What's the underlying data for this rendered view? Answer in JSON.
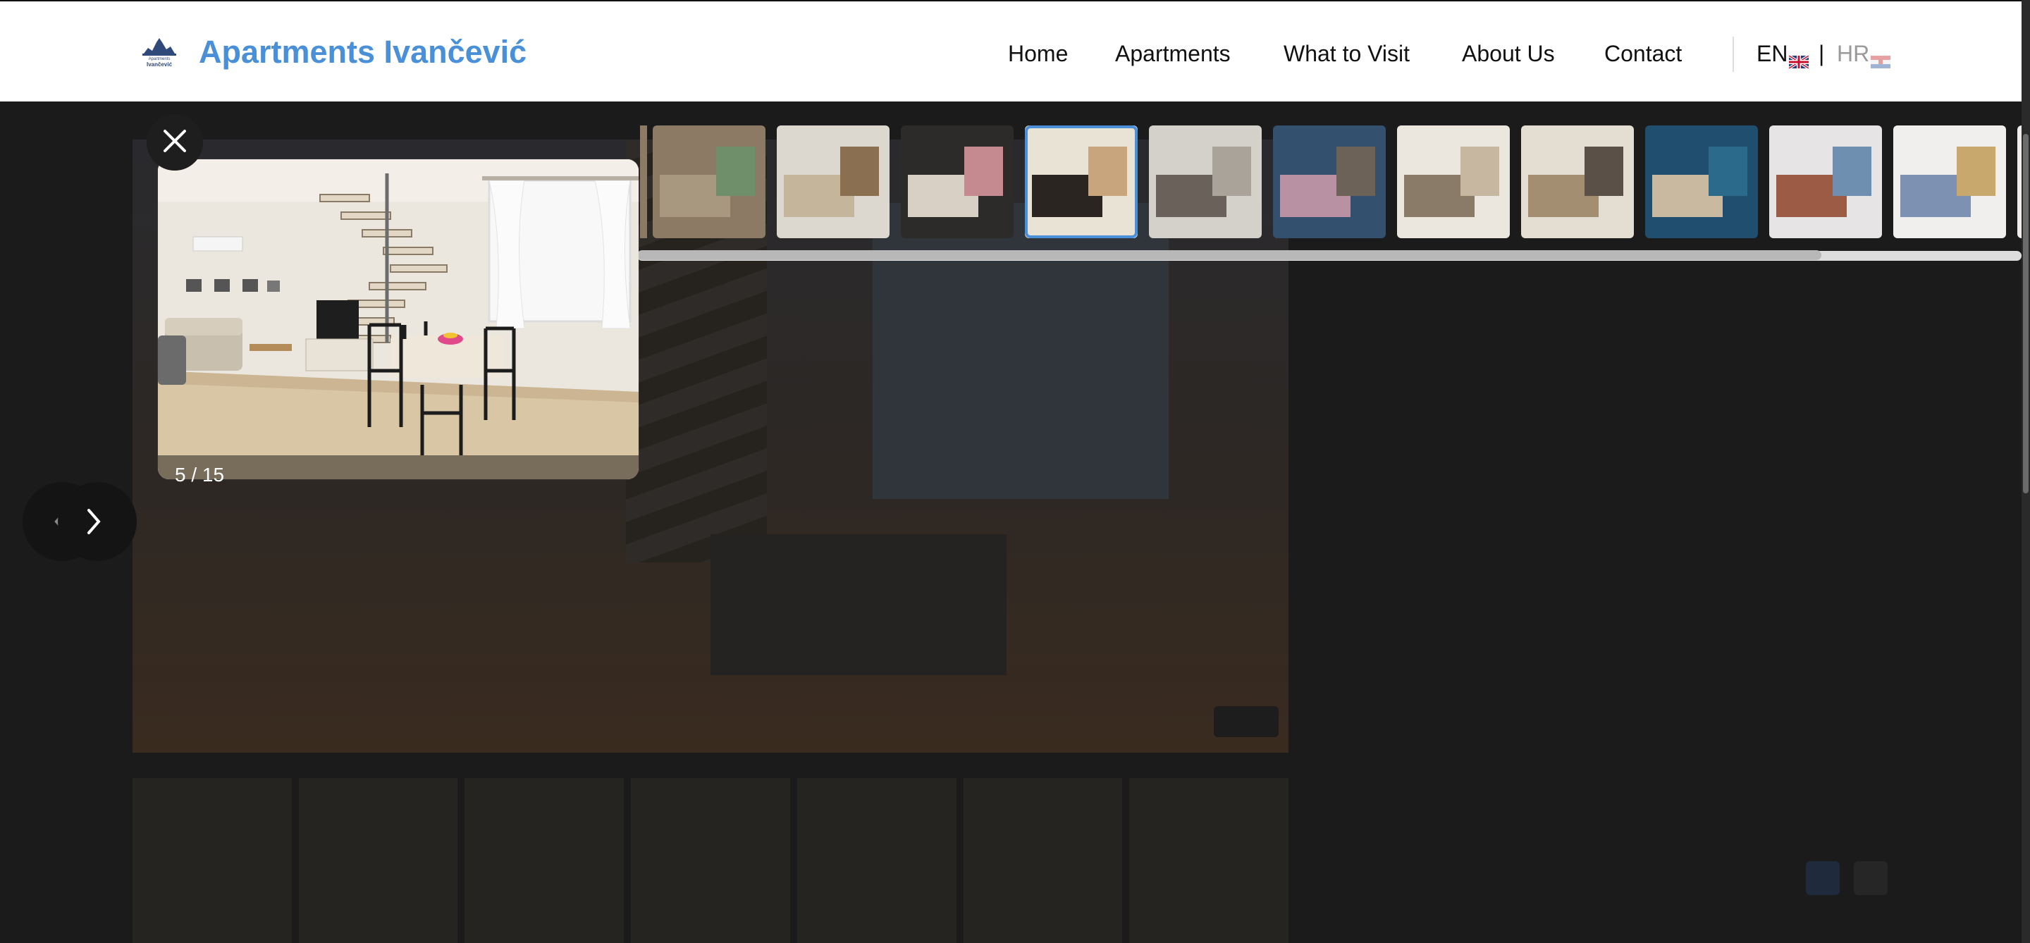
{
  "header": {
    "brand": "Apartments Ivančević",
    "logo_text": "Apartments Ivančević",
    "logo_small_top": "Apartments",
    "logo_small_bottom": "Ivančević",
    "nav": [
      "Home",
      "Apartments",
      "What to Visit",
      "About Us",
      "Contact"
    ],
    "lang_en": "EN",
    "lang_divider": "|",
    "lang_hr": "HR",
    "accent_color": "#4a90d9"
  },
  "lightbox": {
    "counter": "5 / 15",
    "current_index": 5,
    "total": 15,
    "close_icon": "close-icon",
    "prev_icon": "chevron-left-icon",
    "next_icon": "chevron-right-icon",
    "thumbnails": [
      {
        "subject": "stone-house-terrace",
        "colors": [
          "#8c7a64",
          "#a99880",
          "#6f8f6b"
        ]
      },
      {
        "subject": "whiteboard-note",
        "colors": [
          "#dcd7cf",
          "#c5b59a",
          "#8a6f50"
        ]
      },
      {
        "subject": "chalkboard-kitchen",
        "colors": [
          "#2d2b2a",
          "#d8d0c4",
          "#c48a8f"
        ]
      },
      {
        "subject": "living-dining-stairs",
        "colors": [
          "#e9e3d6",
          "#2b2522",
          "#c9a57d"
        ],
        "active": true
      },
      {
        "subject": "kitchen",
        "colors": [
          "#d4d0ca",
          "#6a625a",
          "#a9a39a"
        ]
      },
      {
        "subject": "street-evening",
        "colors": [
          "#34506f",
          "#b892a2",
          "#6c6258"
        ]
      },
      {
        "subject": "kitchen-dining",
        "colors": [
          "#ebe6de",
          "#8a7a68",
          "#c7b6a0"
        ]
      },
      {
        "subject": "living-room",
        "colors": [
          "#e3ddd2",
          "#a38e71",
          "#5a5047"
        ]
      },
      {
        "subject": "aerial-town",
        "colors": [
          "#1f4e6e",
          "#c9b9a0",
          "#2c6a8c"
        ]
      },
      {
        "subject": "bedroom-attic",
        "colors": [
          "#e6e4e4",
          "#9c5b45",
          "#6f8fb0"
        ]
      },
      {
        "subject": "bedroom-twin",
        "colors": [
          "#f0efee",
          "#7d91b3",
          "#c9a86d"
        ]
      },
      {
        "subject": "bedroom-red",
        "colors": [
          "#efece9",
          "#c0342e",
          "#8a6a4e"
        ]
      }
    ]
  },
  "background": {
    "side_item_1": "",
    "side_item_2": "",
    "availability": ""
  }
}
